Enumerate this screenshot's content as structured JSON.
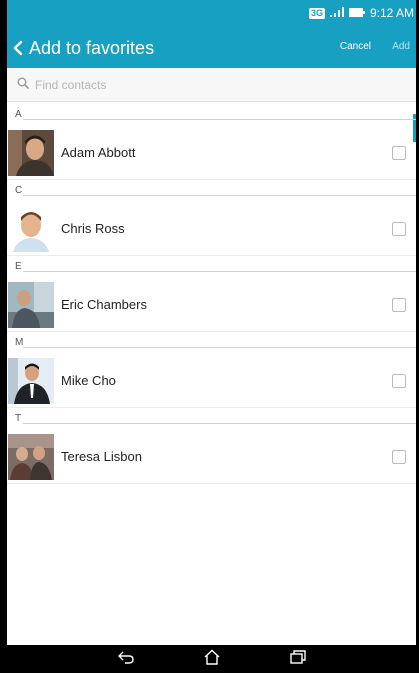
{
  "status_bar": {
    "network": "3G",
    "time": "9:12 AM"
  },
  "app_bar": {
    "title": "Add to favorites",
    "cancel_label": "Cancel",
    "add_label": "Add"
  },
  "search": {
    "placeholder": "Find contacts",
    "value": ""
  },
  "sections": [
    {
      "letter": "A",
      "contacts": [
        {
          "name": "Adam Abbott",
          "checked": false
        }
      ]
    },
    {
      "letter": "C",
      "contacts": [
        {
          "name": "Chris Ross",
          "checked": false
        }
      ]
    },
    {
      "letter": "E",
      "contacts": [
        {
          "name": "Eric Chambers",
          "checked": false
        }
      ]
    },
    {
      "letter": "M",
      "contacts": [
        {
          "name": "Mike Cho",
          "checked": false
        }
      ]
    },
    {
      "letter": "T",
      "contacts": [
        {
          "name": "Teresa Lisbon",
          "checked": false
        }
      ]
    }
  ],
  "colors": {
    "accent": "#17a0c2",
    "navbar": "#000000"
  },
  "icons": {
    "back": "chevron-left-icon",
    "search": "search-icon",
    "nav_back": "back-icon",
    "nav_home": "home-icon",
    "nav_recents": "recents-icon"
  }
}
